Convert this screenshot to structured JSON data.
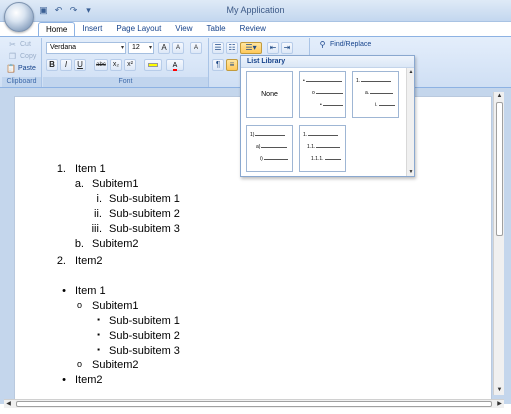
{
  "window": {
    "title": "My Application"
  },
  "qat": {
    "save_icon": "save-icon",
    "undo_icon": "undo-icon",
    "redo_icon": "redo-icon",
    "customize": "▾"
  },
  "tabs": [
    {
      "label": "Home",
      "active": true
    },
    {
      "label": "Insert"
    },
    {
      "label": "Page Layout"
    },
    {
      "label": "View"
    },
    {
      "label": "Table"
    },
    {
      "label": "Review"
    }
  ],
  "clipboard": {
    "cut": "Cut",
    "copy": "Copy",
    "paste": "Paste",
    "label": "Clipboard"
  },
  "font": {
    "family": "Verdana",
    "size": "12",
    "label": "Font",
    "bold": "B",
    "italic": "I",
    "underline": "U",
    "strike": "abc",
    "subscript": "x₂",
    "superscript": "x²",
    "grow": "A",
    "shrink": "A",
    "clear": "A"
  },
  "paragraph": {
    "pilcrow": "¶"
  },
  "editing": {
    "find_replace": "Find/Replace"
  },
  "list_library": {
    "title": "List Library",
    "none_label": "None",
    "bullet_levels": [
      "•",
      "o",
      "•"
    ],
    "numbered_levels": [
      "1.",
      "a.",
      "i."
    ],
    "paren_levels": [
      "1)",
      "a)",
      "i)"
    ],
    "legal_levels": [
      "1.",
      "1.1.",
      "1.1.1."
    ]
  },
  "document": {
    "numbered": [
      {
        "marker": "1.",
        "text": "Item 1",
        "level": 0
      },
      {
        "marker": "a.",
        "text": "Subitem1",
        "level": 1
      },
      {
        "marker": "i.",
        "text": "Sub-subitem 1",
        "level": 2
      },
      {
        "marker": "ii.",
        "text": "Sub-subitem 2",
        "level": 2
      },
      {
        "marker": "iii.",
        "text": "Sub-subitem 3",
        "level": 2
      },
      {
        "marker": "b.",
        "text": "Subitem2",
        "level": 1
      },
      {
        "marker": "2.",
        "text": "Item2",
        "level": 0
      }
    ],
    "bulleted": [
      {
        "marker": "•",
        "text": "Item 1",
        "level": 0
      },
      {
        "marker": "o",
        "text": "Subitem1",
        "level": 1
      },
      {
        "marker": "▪",
        "text": "Sub-subitem 1",
        "level": 2
      },
      {
        "marker": "▪",
        "text": "Sub-subitem 2",
        "level": 2
      },
      {
        "marker": "▪",
        "text": "Sub-subitem 3",
        "level": 2
      },
      {
        "marker": "o",
        "text": "Subitem2",
        "level": 1
      },
      {
        "marker": "•",
        "text": "Item2",
        "level": 0
      }
    ]
  }
}
